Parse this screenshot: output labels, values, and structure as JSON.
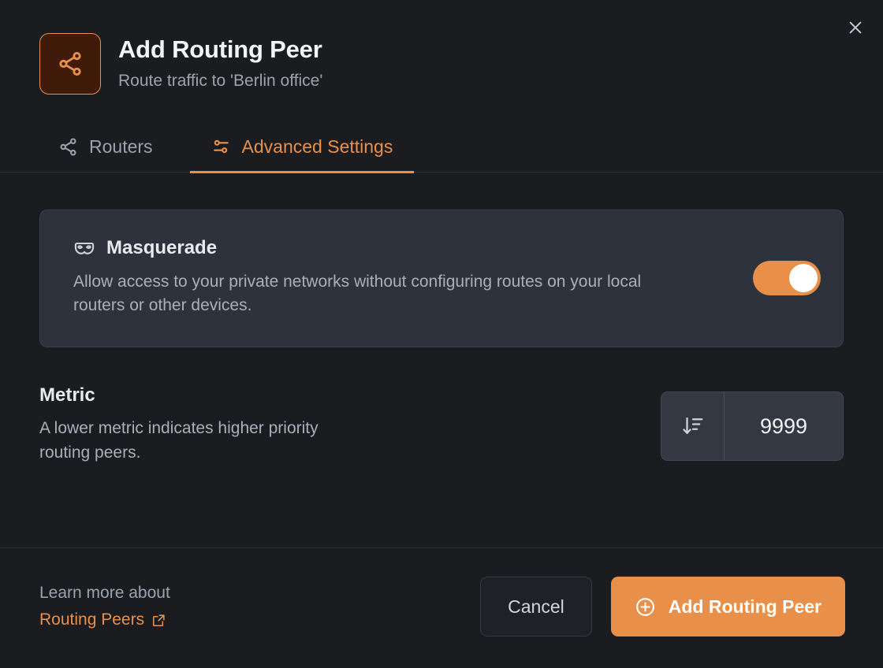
{
  "window": {
    "close_icon": "close-icon"
  },
  "header": {
    "icon": "share-nodes-icon",
    "title": "Add Routing Peer",
    "subtitle": "Route traffic to 'Berlin office'"
  },
  "tabs": [
    {
      "id": "routers",
      "label": "Routers",
      "icon": "share-nodes-icon",
      "active": false
    },
    {
      "id": "advanced",
      "label": "Advanced Settings",
      "icon": "sliders-icon",
      "active": true
    }
  ],
  "masquerade": {
    "icon": "mask-icon",
    "title": "Masquerade",
    "description": "Allow access to your private networks without configuring routes on your local routers or other devices.",
    "toggle_state": "on"
  },
  "metric": {
    "title": "Metric",
    "description": "A lower metric indicates higher priority routing peers.",
    "icon": "sort-descending-icon",
    "value": "9999",
    "placeholder": "9999"
  },
  "footer": {
    "learn_more_text": "Learn more about",
    "learn_more_link": "Routing Peers",
    "external_link_icon": "external-link-icon",
    "cancel_label": "Cancel",
    "submit_label": "Add Routing Peer",
    "submit_icon": "plus-circle-icon"
  },
  "colors": {
    "accent": "#e8904a",
    "page_bg": "#1a1c20",
    "card_bg": "#2e323c",
    "input_bg": "#343842",
    "text_primary": "#e9eaed",
    "text_muted": "#9ba3ae"
  }
}
